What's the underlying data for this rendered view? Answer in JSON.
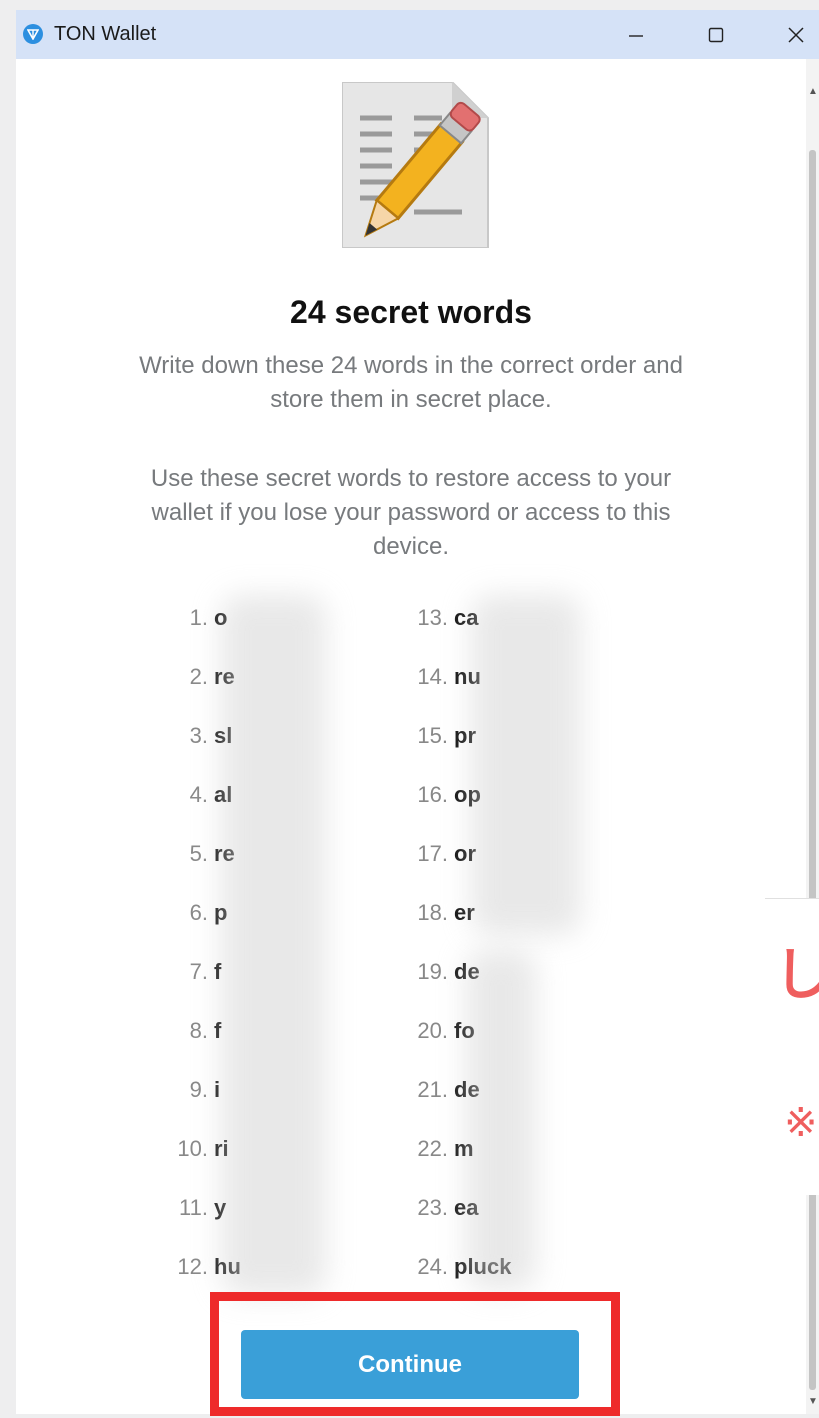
{
  "window": {
    "title": "TON Wallet"
  },
  "header": {
    "title": "24 secret words",
    "description_1": "Write down these 24 words in the correct order and store them in secret place.",
    "description_2": "Use these secret words to restore access to your wallet if you lose your password or access to this device."
  },
  "words_left": [
    {
      "num": "1.",
      "text": "o"
    },
    {
      "num": "2.",
      "text": "re"
    },
    {
      "num": "3.",
      "text": "sl"
    },
    {
      "num": "4.",
      "text": "al"
    },
    {
      "num": "5.",
      "text": "re"
    },
    {
      "num": "6.",
      "text": "p"
    },
    {
      "num": "7.",
      "text": "f"
    },
    {
      "num": "8.",
      "text": "f"
    },
    {
      "num": "9.",
      "text": "i"
    },
    {
      "num": "10.",
      "text": "ri"
    },
    {
      "num": "11.",
      "text": "y"
    },
    {
      "num": "12.",
      "text": "hu"
    }
  ],
  "words_right": [
    {
      "num": "13.",
      "text": "ca"
    },
    {
      "num": "14.",
      "text": "nu"
    },
    {
      "num": "15.",
      "text": "pr"
    },
    {
      "num": "16.",
      "text": "op"
    },
    {
      "num": "17.",
      "text": "or"
    },
    {
      "num": "18.",
      "text": "er"
    },
    {
      "num": "19.",
      "text": "de"
    },
    {
      "num": "20.",
      "text": "fo"
    },
    {
      "num": "21.",
      "text": "de"
    },
    {
      "num": "22.",
      "text": "m"
    },
    {
      "num": "23.",
      "text": "ea"
    },
    {
      "num": "24.",
      "text": "pluck"
    }
  ],
  "actions": {
    "continue_label": "Continue"
  },
  "side_marks": {
    "mark_1": "し",
    "mark_2": "※"
  },
  "colors": {
    "accent": "#3a9fd8",
    "highlight": "#ee2a2a",
    "titlebar": "#d5e2f7"
  }
}
